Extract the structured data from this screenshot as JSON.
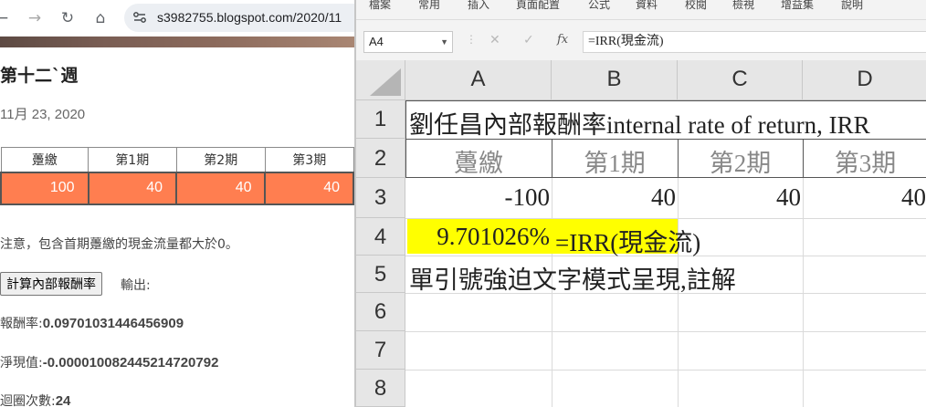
{
  "browser": {
    "url": "s3982755.blogspot.com/2020/11",
    "post_title": "第十二`週",
    "post_date": "11月 23, 2020",
    "table": {
      "headers": [
        "躉繳",
        "第1期",
        "第2期",
        "第3期"
      ],
      "values": [
        "100",
        "40",
        "40",
        "40"
      ]
    },
    "note": "注意，包含首期躉繳的現金流量都大於0。",
    "calc_button_label": "計算內部報酬率",
    "output_label": "輸出:",
    "results": [
      {
        "label": "報酬率:",
        "value": "0.09701031446456909"
      },
      {
        "label": "淨現值:",
        "value": "-0.000010082445214720792"
      },
      {
        "label": "迴圈次數:",
        "value": "24"
      }
    ]
  },
  "excel": {
    "ribbon_tabs": [
      "檔案",
      "常用",
      "插入",
      "頁面配置",
      "公式",
      "資料",
      "校閱",
      "檢視",
      "增益集",
      "說明"
    ],
    "name_box": "A4",
    "fx_symbol": "fx",
    "formula": "=IRR(現金流)",
    "column_headers": [
      "A",
      "B",
      "C",
      "D"
    ],
    "row_headers": [
      "1",
      "2",
      "3",
      "4",
      "5",
      "6",
      "7",
      "8"
    ],
    "cells": {
      "A1": "劉任昌內部報酬率internal rate of return, IRR",
      "A2": "躉繳",
      "B2": "第1期",
      "C2": "第2期",
      "D2": "第3期",
      "A3": "-100",
      "B3": "40",
      "C3": "40",
      "D3": "40",
      "A4": "9.701026%",
      "B4": "=IRR(現金流)",
      "A5": "單引號強迫文字模式呈現,註解"
    },
    "highlight_color": "#ffff00"
  }
}
